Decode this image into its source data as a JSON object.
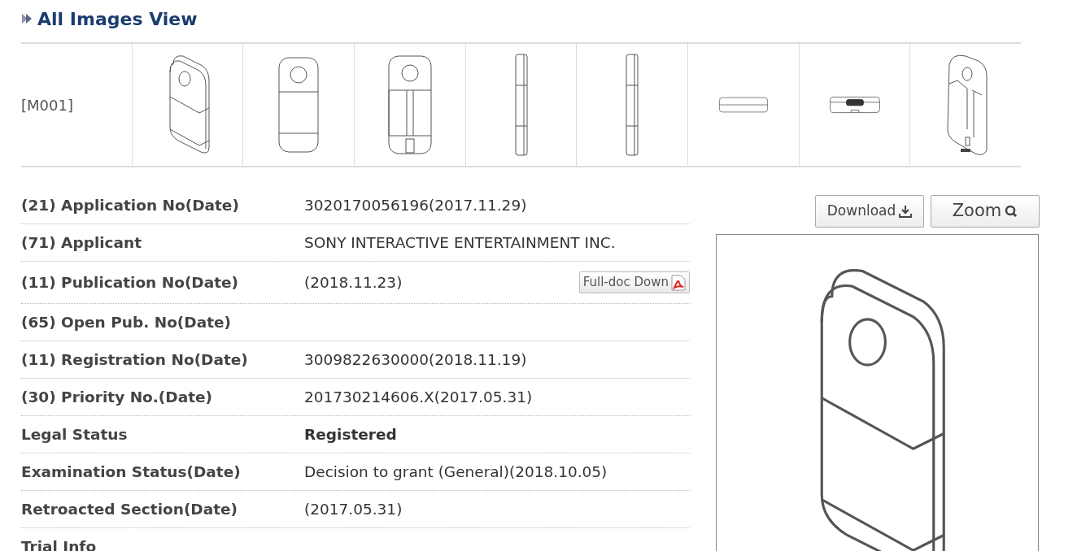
{
  "title": "All Images View",
  "gallery": {
    "label": "[M001]",
    "thumbnails": [
      {
        "kind": "perspective"
      },
      {
        "kind": "front"
      },
      {
        "kind": "back"
      },
      {
        "kind": "side"
      },
      {
        "kind": "side"
      },
      {
        "kind": "top"
      },
      {
        "kind": "bottom"
      },
      {
        "kind": "rear-perspective"
      }
    ]
  },
  "details": [
    {
      "label": "(21) Application No(Date)",
      "value": "3020170056196(2017.11.29)"
    },
    {
      "label": "(71) Applicant",
      "value": "SONY INTERACTIVE ENTERTAINMENT INC."
    },
    {
      "label": "(11) Publication No(Date)",
      "value": "(2018.11.23)",
      "button": "Full-doc Down"
    },
    {
      "label": "(65) Open Pub. No(Date)"
    },
    {
      "label": "(11) Registration No(Date)",
      "value": "3009822630000(2018.11.19)"
    },
    {
      "label": "(30) Priority No.(Date)",
      "value": "201730214606.X(2017.05.31)"
    },
    {
      "label": "Legal Status",
      "value": "Registered",
      "emphasis": true
    },
    {
      "label": "Examination Status(Date)",
      "value": "Decision to grant (General)(2018.10.05)"
    },
    {
      "label": "Retroacted Section(Date)",
      "value": "(2017.05.31)"
    },
    {
      "label": "Trial Info"
    }
  ],
  "viewer": {
    "buttons": [
      "Download",
      "Zoom"
    ],
    "image": {
      "kind": "perspective"
    }
  }
}
